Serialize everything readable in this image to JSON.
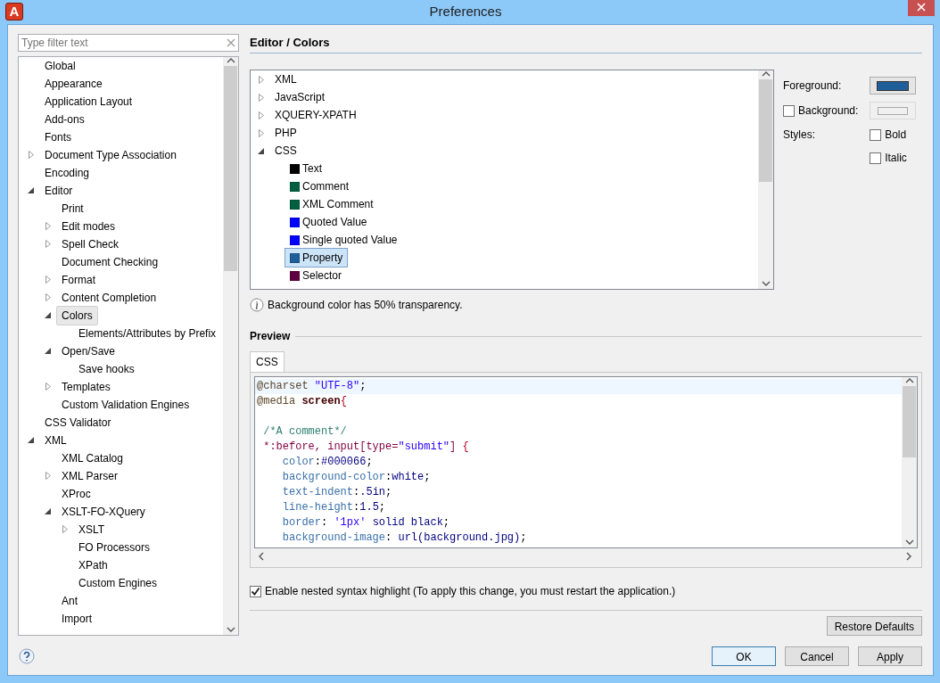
{
  "window": {
    "title": "Preferences",
    "logo_letter": "A"
  },
  "filter": {
    "placeholder": "Type filter text"
  },
  "nav_tree": [
    {
      "label": "Global",
      "selected": false
    },
    {
      "label": "Appearance",
      "selected": false
    },
    {
      "label": "Application Layout",
      "selected": false
    },
    {
      "label": "Add-ons",
      "selected": false
    },
    {
      "label": "Fonts",
      "selected": false
    },
    {
      "label": "Document Type Association",
      "selected": false,
      "expanded": false
    },
    {
      "label": "Encoding",
      "selected": false
    },
    {
      "label": "Editor",
      "selected": false,
      "expanded": true,
      "children": [
        {
          "label": "Print",
          "selected": false
        },
        {
          "label": "Edit modes",
          "selected": false,
          "expanded": false
        },
        {
          "label": "Spell Check",
          "selected": false,
          "expanded": false
        },
        {
          "label": "Document Checking",
          "selected": false
        },
        {
          "label": "Format",
          "selected": false,
          "expanded": false
        },
        {
          "label": "Content Completion",
          "selected": false,
          "expanded": false
        },
        {
          "label": "Colors",
          "selected": true,
          "expanded": true,
          "children": [
            {
              "label": "Elements/Attributes by Prefix",
              "selected": false
            }
          ]
        },
        {
          "label": "Open/Save",
          "selected": false,
          "expanded": true,
          "children": [
            {
              "label": "Save hooks",
              "selected": false
            }
          ]
        },
        {
          "label": "Templates",
          "selected": false,
          "expanded": false
        },
        {
          "label": "Custom Validation Engines",
          "selected": false
        }
      ]
    },
    {
      "label": "CSS Validator",
      "selected": false
    },
    {
      "label": "XML",
      "selected": false,
      "expanded": true,
      "children": [
        {
          "label": "XML Catalog",
          "selected": false
        },
        {
          "label": "XML Parser",
          "selected": false,
          "expanded": false
        },
        {
          "label": "XProc",
          "selected": false
        },
        {
          "label": "XSLT-FO-XQuery",
          "selected": false,
          "expanded": true,
          "children": [
            {
              "label": "XSLT",
              "selected": false,
              "expanded": false
            },
            {
              "label": "FO Processors",
              "selected": false
            },
            {
              "label": "XPath",
              "selected": false
            },
            {
              "label": "Custom Engines",
              "selected": false
            }
          ]
        },
        {
          "label": "Ant",
          "selected": false
        },
        {
          "label": "Import",
          "selected": false
        }
      ]
    }
  ],
  "page_title": "Editor / Colors",
  "color_tree": [
    {
      "label": "XML",
      "expanded": false
    },
    {
      "label": "JavaScript",
      "expanded": false
    },
    {
      "label": "XQUERY-XPATH",
      "expanded": false
    },
    {
      "label": "PHP",
      "expanded": false
    },
    {
      "label": "CSS",
      "expanded": true,
      "children": [
        {
          "label": "Text",
          "color": "#000000",
          "selected": false
        },
        {
          "label": "Comment",
          "color": "#006040",
          "selected": false
        },
        {
          "label": "XML Comment",
          "color": "#006040",
          "selected": false
        },
        {
          "label": "Quoted Value",
          "color": "#0000ff",
          "selected": false
        },
        {
          "label": "Single quoted Value",
          "color": "#0000ff",
          "selected": false
        },
        {
          "label": "Property",
          "color": "#1f5f99",
          "selected": true
        },
        {
          "label": "Selector",
          "color": "#600040",
          "selected": false
        }
      ]
    }
  ],
  "info_note": "Background color has 50% transparency.",
  "foreground": {
    "label": "Foreground:",
    "color": "#1f5f99"
  },
  "background": {
    "label": "Background:",
    "checked": false
  },
  "styles": {
    "label": "Styles:",
    "options": [
      {
        "label": "Bold",
        "checked": false
      },
      {
        "label": "Italic",
        "checked": false
      }
    ]
  },
  "preview": {
    "heading": "Preview",
    "tabs": [
      {
        "label": "CSS",
        "selected": true
      }
    ],
    "lines": [
      {
        "kind": "code",
        "current": true,
        "tokens": [
          {
            "kind": "at",
            "text": "@charset "
          },
          {
            "kind": "string",
            "text": "\"UTF-8\""
          },
          {
            "kind": "plain",
            "text": ";"
          }
        ]
      },
      {
        "kind": "code",
        "current": false,
        "tokens": [
          {
            "kind": "at",
            "text": "@media "
          },
          {
            "kind": "bold",
            "text": "screen"
          },
          {
            "kind": "punct",
            "text": "{"
          }
        ]
      },
      {
        "kind": "blank",
        "current": false
      },
      {
        "kind": "code",
        "current": false,
        "tokens": [
          {
            "kind": "comment",
            "text": " /*A comment*/"
          }
        ]
      },
      {
        "kind": "code",
        "current": false,
        "tokens": [
          {
            "kind": "selector",
            "text": " *:before, input[type="
          },
          {
            "kind": "string",
            "text": "\"submit\""
          },
          {
            "kind": "selector",
            "text": "] "
          },
          {
            "kind": "punct",
            "text": "{"
          }
        ]
      },
      {
        "kind": "code",
        "current": false,
        "tokens": [
          {
            "kind": "property",
            "text": "    color"
          },
          {
            "kind": "plain",
            "text": ":"
          },
          {
            "kind": "value",
            "text": "#000066"
          },
          {
            "kind": "plain",
            "text": ";"
          }
        ]
      },
      {
        "kind": "code",
        "current": false,
        "tokens": [
          {
            "kind": "property",
            "text": "    background-color"
          },
          {
            "kind": "plain",
            "text": ":"
          },
          {
            "kind": "value",
            "text": "white"
          },
          {
            "kind": "plain",
            "text": ";"
          }
        ]
      },
      {
        "kind": "code",
        "current": false,
        "tokens": [
          {
            "kind": "property",
            "text": "    text-indent"
          },
          {
            "kind": "plain",
            "text": ":"
          },
          {
            "kind": "value",
            "text": ".5in"
          },
          {
            "kind": "plain",
            "text": ";"
          }
        ]
      },
      {
        "kind": "code",
        "current": false,
        "tokens": [
          {
            "kind": "property",
            "text": "    line-height"
          },
          {
            "kind": "plain",
            "text": ":"
          },
          {
            "kind": "value",
            "text": "1.5"
          },
          {
            "kind": "plain",
            "text": ";"
          }
        ]
      },
      {
        "kind": "code",
        "current": false,
        "tokens": [
          {
            "kind": "property",
            "text": "    border"
          },
          {
            "kind": "plain",
            "text": ": "
          },
          {
            "kind": "string",
            "text": "'1px'"
          },
          {
            "kind": "value",
            "text": " solid black"
          },
          {
            "kind": "plain",
            "text": ";"
          }
        ]
      },
      {
        "kind": "code",
        "current": false,
        "tokens": [
          {
            "kind": "property",
            "text": "    background-image"
          },
          {
            "kind": "plain",
            "text": ": "
          },
          {
            "kind": "value",
            "text": "url(background.jpg)"
          },
          {
            "kind": "plain",
            "text": ";"
          }
        ]
      }
    ]
  },
  "nested_highlight": {
    "label": "Enable nested syntax highlight (To apply this change, you must restart the application.)",
    "checked": true
  },
  "restore_button": "Restore Defaults",
  "buttons": [
    {
      "label": "OK",
      "default": true
    },
    {
      "label": "Cancel",
      "default": false
    },
    {
      "label": "Apply",
      "default": false
    }
  ]
}
